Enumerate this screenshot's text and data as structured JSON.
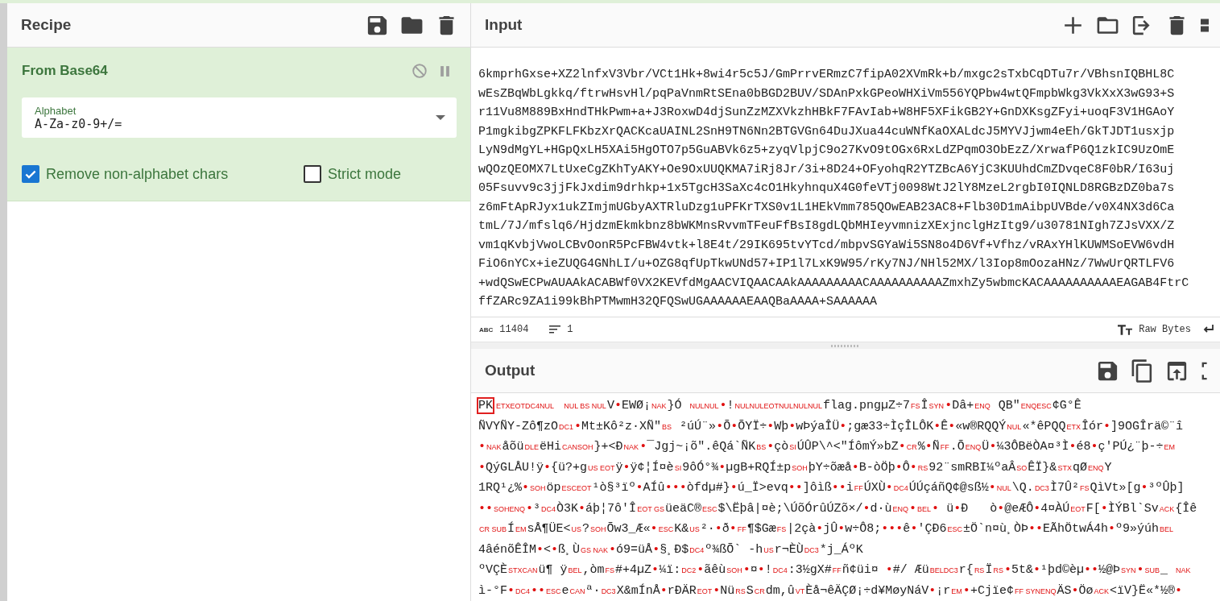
{
  "recipe": {
    "title": "Recipe",
    "operations": [
      {
        "name": "From Base64",
        "args": [
          {
            "kind": "dropdown",
            "label": "Alphabet",
            "value": "A-Za-z0-9+/="
          },
          {
            "kind": "checkbox",
            "label": "Remove non-alphabet chars",
            "checked": true
          },
          {
            "kind": "checkbox",
            "label": "Strict mode",
            "checked": false
          }
        ]
      }
    ]
  },
  "input": {
    "title": "Input",
    "lines": [
      "6kmprhGxse+XZ2lnfxV3Vbr/VCt1Hk+8wi4r5c5J/GmPrrvERmzC7fipA02XVmRk+b/mxgc2sTxbCqDTu7r/VBhsnIQBHL8C",
      "wEsZBqWbLgkkq/ftrwHsvHl/pqPaVnmRtSEna0bBGD2BUV/SDAnPxkGPeoWHXiVm556YQPbw4wtQFmpbWkg3VkXxX3wG93+S",
      "r11Vu8M889BxHndTHkPwm+a+J3RoxwD4djSunZzMZXVkzhHBkF7FAvIab+W8HF5XFikGB2Y+GnDXKsgZFyi+uoqF3V1HGAoY",
      "P1mgkibgZPKFLFKbzXrQACKcaUAINL2SnH9TN6Nn2BTGVGn64DuJXua44cuWNfKaOXALdcJ5MYVJjwm4eEh/GkTJDT1usxjp",
      "LyN9dMgYL+HGpQxLH5XAi5HgOTO7p5GuABVk6z5+zyqVlpjC9o27KvO9tOGx6RxLdZPqmO3ObEzZ/XrwafP6Q1zkIC9UzOmE",
      "wQOzQEOMX7LtUxeCgZKhTyAKY+Oe9OxUUQKMA7iRj8Jr/3i+8D24+OFyohqR2YTZBcA6YjC3KUUhdCmZDvqeC8F0bR/I63uj",
      "05Fsuvv9c3jjFkJxdim9drhkp+1x5TgcH3SaXc4cO1HkyhnquX4G0feVTj0098WtJ2lY8MzeL2rgbI0IQNLD8RGBzDZ0ba7s",
      "z6mFtApRJyx1ukZImjmUGbyAXTRluDzg1uPFKrTXS0v1L1HEkVmm785QOwEAB23AC8+Flb30D1mAibpUVBde/v0X4NX3d6Ca",
      "tmL/7J/mfslq6/HjdzmEkmkbnz8bWKMnsRvvmTFeuFfBsI8gdLQbMHIeyvmnizXExjnclgHzItg9/u30781NIgh7ZJsVXX/Z",
      "vm1qKvbjVwoLCBvOonR5PcFBW4vtk+l8E4t/29IK695tvYTcd/mbpvSGYaWi5SN8o4D6Vf+Vfhz/vRAxYHlKUWMSoEVW6vdH",
      "FiO6nYCx+ieZUQG4GNhLI/u+OZG8qfUpTkwUNd57+IP1l7LxK9W95/rKy7NJ/NHl52MX/l3Iop8mOozaHNz/7WwUrQRTLFV6",
      "+wdQSwECPwAUAAkACABWf0VX2KEVfdMgAACVIQAACAAkAAAAAAAAACAAAAAAAAAAZmxhZy5wbmcKACAAAAAAAAAAEAGAB4FtrC",
      "ffZARc9ZA1i99kBhPTMwmH32QFQSwUGAAAAAAEAAQBaAAAA+SAAAAAA"
    ],
    "status": {
      "length_label": "ABC",
      "length": "11404",
      "lines": "1",
      "encoding": "Raw Bytes"
    }
  },
  "output": {
    "title": "Output",
    "lines": [
      [
        {
          "kind": "marked",
          "text": "PK"
        },
        {
          "kind": "ctrl",
          "text": "ETXEOTDC4NUL     NUL BS NUL"
        },
        {
          "kind": "text",
          "text": "V"
        },
        {
          "kind": "dot",
          "text": "•"
        },
        {
          "kind": "text",
          "text": "EWØ¡"
        },
        {
          "kind": "ctrl",
          "text": "NAK"
        },
        {
          "kind": "text",
          "text": "}Ó "
        },
        {
          "kind": "ctrl",
          "text": "NULNUL"
        },
        {
          "kind": "dot",
          "text": "•"
        },
        {
          "kind": "text",
          "text": "!"
        },
        {
          "kind": "ctrl",
          "text": "NULNULEOTNULNULNUL"
        },
        {
          "kind": "text",
          "text": "flag.pngµZ÷7"
        },
        {
          "kind": "ctrl",
          "text": "FS"
        },
        {
          "kind": "text",
          "text": "Î"
        },
        {
          "kind": "ctrl",
          "text": "SYN"
        },
        {
          "kind": "dot",
          "text": "•"
        },
        {
          "kind": "text",
          "text": "Dâ+"
        },
        {
          "kind": "ctrl",
          "text": "ENQ"
        },
        {
          "kind": "text",
          "text": " QB\""
        },
        {
          "kind": "ctrl",
          "text": "ENQESC"
        },
        {
          "kind": "text",
          "text": "¢G°Ê"
        }
      ],
      [
        {
          "kind": "text",
          "text": "ÑVYÑY-Zô¶zO"
        },
        {
          "kind": "ctrl",
          "text": "DC1"
        },
        {
          "kind": "dot",
          "text": "•"
        },
        {
          "kind": "text",
          "text": "Mt±Kô²z·XÑ\""
        },
        {
          "kind": "ctrl",
          "text": "BS"
        },
        {
          "kind": "text",
          "text": " ²úÚ¨»"
        },
        {
          "kind": "dot",
          "text": "•"
        },
        {
          "kind": "text",
          "text": "Õ"
        },
        {
          "kind": "dot",
          "text": "•"
        },
        {
          "kind": "text",
          "text": "ÕYÏ÷"
        },
        {
          "kind": "dot",
          "text": "•"
        },
        {
          "kind": "text",
          "text": "Wþ"
        },
        {
          "kind": "dot",
          "text": "•"
        },
        {
          "kind": "text",
          "text": "wÞýaÎÜ"
        },
        {
          "kind": "dot",
          "text": "•"
        },
        {
          "kind": "text",
          "text": ";gæ33÷ÌçÎLÔK"
        },
        {
          "kind": "dot",
          "text": "•"
        },
        {
          "kind": "text",
          "text": "Ê"
        },
        {
          "kind": "dot",
          "text": "•"
        },
        {
          "kind": "text",
          "text": "«w®RQQÝ"
        },
        {
          "kind": "ctrl",
          "text": "NUL"
        },
        {
          "kind": "text",
          "text": "«*êPQQ"
        },
        {
          "kind": "ctrl",
          "text": "ETX"
        },
        {
          "kind": "text",
          "text": "Îór"
        },
        {
          "kind": "dot",
          "text": "•"
        },
        {
          "kind": "text",
          "text": "]9OGÎrä©¨î"
        }
      ],
      [
        {
          "kind": "dot",
          "text": "•"
        },
        {
          "kind": "ctrl",
          "text": "NAK"
        },
        {
          "kind": "text",
          "text": "åõü"
        },
        {
          "kind": "ctrl",
          "text": "DLE"
        },
        {
          "kind": "text",
          "text": "ëHi"
        },
        {
          "kind": "ctrl",
          "text": "CANSOH"
        },
        {
          "kind": "text",
          "text": "}+<Ð"
        },
        {
          "kind": "ctrl",
          "text": "NAK"
        },
        {
          "kind": "dot",
          "text": "•"
        },
        {
          "kind": "text",
          "text": "¯Jgj~¡õ\".êQá`ÑK"
        },
        {
          "kind": "ctrl",
          "text": "BS"
        },
        {
          "kind": "dot",
          "text": "•"
        },
        {
          "kind": "text",
          "text": "çò"
        },
        {
          "kind": "ctrl",
          "text": "SI"
        },
        {
          "kind": "text",
          "text": "ÚÛP\\^<\"ÍômÝ»bZ"
        },
        {
          "kind": "dot",
          "text": "•"
        },
        {
          "kind": "ctrl",
          "text": "CR"
        },
        {
          "kind": "text",
          "text": "%"
        },
        {
          "kind": "dot",
          "text": "•"
        },
        {
          "kind": "text",
          "text": "Ñ"
        },
        {
          "kind": "ctrl",
          "text": "FF"
        },
        {
          "kind": "text",
          "text": ".Õ"
        },
        {
          "kind": "ctrl",
          "text": "ENQ"
        },
        {
          "kind": "text",
          "text": "Ü"
        },
        {
          "kind": "dot",
          "text": "•"
        },
        {
          "kind": "text",
          "text": "¼3ÔBëÒA¤³Ì"
        },
        {
          "kind": "dot",
          "text": "•"
        },
        {
          "kind": "text",
          "text": "é8"
        },
        {
          "kind": "dot",
          "text": "•"
        },
        {
          "kind": "text",
          "text": "ç'PÚ¿¨þ-÷"
        },
        {
          "kind": "ctrl",
          "text": "EM"
        }
      ],
      [
        {
          "kind": "dot",
          "text": "•"
        },
        {
          "kind": "text",
          "text": "QýGLÅU!ÿ"
        },
        {
          "kind": "dot",
          "text": "•"
        },
        {
          "kind": "text",
          "text": "{ü?+g"
        },
        {
          "kind": "ctrl",
          "text": "US EOT"
        },
        {
          "kind": "text",
          "text": "ÿ"
        },
        {
          "kind": "dot",
          "text": "•"
        },
        {
          "kind": "text",
          "text": "ÿ¢¦Í¤è"
        },
        {
          "kind": "ctrl",
          "text": "SI"
        },
        {
          "kind": "text",
          "text": "9ôÓ°¾"
        },
        {
          "kind": "dot",
          "text": "•"
        },
        {
          "kind": "text",
          "text": "µgB+RQÍ±p"
        },
        {
          "kind": "ctrl",
          "text": "SOH"
        },
        {
          "kind": "text",
          "text": "þY÷õæå"
        },
        {
          "kind": "dot",
          "text": "•"
        },
        {
          "kind": "text",
          "text": "B-òÖþ"
        },
        {
          "kind": "dot",
          "text": "•"
        },
        {
          "kind": "text",
          "text": "Ô"
        },
        {
          "kind": "dot",
          "text": "•"
        },
        {
          "kind": "ctrl",
          "text": "RS"
        },
        {
          "kind": "text",
          "text": "92¨smRBI¼ºaÂ"
        },
        {
          "kind": "ctrl",
          "text": "SO"
        },
        {
          "kind": "text",
          "text": "ÊÏ}&"
        },
        {
          "kind": "ctrl",
          "text": "STX"
        },
        {
          "kind": "text",
          "text": "qØ"
        },
        {
          "kind": "ctrl",
          "text": "ENQ"
        },
        {
          "kind": "text",
          "text": "Y"
        }
      ],
      [
        {
          "kind": "text",
          "text": "1RQ¹¿%"
        },
        {
          "kind": "dot",
          "text": "•"
        },
        {
          "kind": "ctrl",
          "text": "SOH"
        },
        {
          "kind": "text",
          "text": "öp"
        },
        {
          "kind": "ctrl",
          "text": "ESCEOT"
        },
        {
          "kind": "text",
          "text": "¹ò§³ïº"
        },
        {
          "kind": "dot",
          "text": "•"
        },
        {
          "kind": "text",
          "text": "AÍû"
        },
        {
          "kind": "dot",
          "text": "•••"
        },
        {
          "kind": "text",
          "text": "òfdµ#}"
        },
        {
          "kind": "dot",
          "text": "•"
        },
        {
          "kind": "text",
          "text": "ú_Ï>evq"
        },
        {
          "kind": "dot",
          "text": "••"
        },
        {
          "kind": "text",
          "text": "]ôìß"
        },
        {
          "kind": "dot",
          "text": "••"
        },
        {
          "kind": "text",
          "text": "i"
        },
        {
          "kind": "ctrl",
          "text": "FF"
        },
        {
          "kind": "text",
          "text": "ÚXÙ"
        },
        {
          "kind": "dot",
          "text": "•"
        },
        {
          "kind": "ctrl",
          "text": "DC4"
        },
        {
          "kind": "text",
          "text": "ÚÚçáñQ¢@sß½"
        },
        {
          "kind": "dot",
          "text": "•"
        },
        {
          "kind": "ctrl",
          "text": "NUL"
        },
        {
          "kind": "text",
          "text": "\\Q."
        },
        {
          "kind": "ctrl",
          "text": "DC3"
        },
        {
          "kind": "text",
          "text": "Ì7Û²"
        },
        {
          "kind": "ctrl",
          "text": "FS"
        },
        {
          "kind": "text",
          "text": "QìVt»[g"
        },
        {
          "kind": "dot",
          "text": "•"
        },
        {
          "kind": "text",
          "text": "³ºÛþ]"
        }
      ],
      [
        {
          "kind": "dot",
          "text": "••"
        },
        {
          "kind": "ctrl",
          "text": "SOHENQ"
        },
        {
          "kind": "dot",
          "text": "•"
        },
        {
          "kind": "text",
          "text": "³"
        },
        {
          "kind": "ctrl",
          "text": "DC4"
        },
        {
          "kind": "text",
          "text": "Ò3K"
        },
        {
          "kind": "dot",
          "text": "•"
        },
        {
          "kind": "text",
          "text": "áþ¦7ô'Î"
        },
        {
          "kind": "ctrl",
          "text": "EOT GS"
        },
        {
          "kind": "text",
          "text": "üeäC®"
        },
        {
          "kind": "ctrl",
          "text": "ESC"
        },
        {
          "kind": "text",
          "text": "$\\Ëþâ|¤è;\\ÚõÓrûÚZõ×/"
        },
        {
          "kind": "dot",
          "text": "•"
        },
        {
          "kind": "text",
          "text": "d·ù"
        },
        {
          "kind": "ctrl",
          "text": "ENQ"
        },
        {
          "kind": "dot",
          "text": "•"
        },
        {
          "kind": "ctrl",
          "text": "BEL"
        },
        {
          "kind": "dot",
          "text": "•"
        },
        {
          "kind": "text",
          "text": " ü"
        },
        {
          "kind": "dot",
          "text": "•"
        },
        {
          "kind": "text",
          "text": "Ð   ò"
        },
        {
          "kind": "dot",
          "text": "•"
        },
        {
          "kind": "text",
          "text": "@eÆÔ"
        },
        {
          "kind": "dot",
          "text": "•"
        },
        {
          "kind": "text",
          "text": "4¤ÀÚ"
        },
        {
          "kind": "ctrl",
          "text": "EOT"
        },
        {
          "kind": "text",
          "text": "F["
        },
        {
          "kind": "dot",
          "text": "•"
        },
        {
          "kind": "text",
          "text": "ÌÝBl`Sv"
        },
        {
          "kind": "ctrl",
          "text": "ACK"
        },
        {
          "kind": "text",
          "text": "{Îê"
        }
      ],
      [
        {
          "kind": "ctrl",
          "text": "CR SUB"
        },
        {
          "kind": "text",
          "text": "Í"
        },
        {
          "kind": "ctrl",
          "text": "EM"
        },
        {
          "kind": "text",
          "text": "sÅ¶ÜE<"
        },
        {
          "kind": "ctrl",
          "text": "US"
        },
        {
          "kind": "text",
          "text": "?"
        },
        {
          "kind": "ctrl",
          "text": "SOH"
        },
        {
          "kind": "text",
          "text": "Õw3_Æ«"
        },
        {
          "kind": "dot",
          "text": "•"
        },
        {
          "kind": "ctrl",
          "text": "ESC"
        },
        {
          "kind": "text",
          "text": "K&"
        },
        {
          "kind": "ctrl",
          "text": "US"
        },
        {
          "kind": "text",
          "text": "²·"
        },
        {
          "kind": "dot",
          "text": "•"
        },
        {
          "kind": "text",
          "text": "ð"
        },
        {
          "kind": "dot",
          "text": "•"
        },
        {
          "kind": "ctrl",
          "text": "FF"
        },
        {
          "kind": "text",
          "text": "¶$Gæ"
        },
        {
          "kind": "ctrl",
          "text": "FS"
        },
        {
          "kind": "text",
          "text": "|2çà"
        },
        {
          "kind": "dot",
          "text": "•"
        },
        {
          "kind": "text",
          "text": "jÛ"
        },
        {
          "kind": "dot",
          "text": "•"
        },
        {
          "kind": "text",
          "text": "w÷Ô8;"
        },
        {
          "kind": "dot",
          "text": "•••"
        },
        {
          "kind": "text",
          "text": "ê"
        },
        {
          "kind": "dot",
          "text": "•"
        },
        {
          "kind": "text",
          "text": "'ÇÐ6"
        },
        {
          "kind": "ctrl",
          "text": "ESC"
        },
        {
          "kind": "text",
          "text": "±Ö`n¤ù¸ÒÞ"
        },
        {
          "kind": "dot",
          "text": "••"
        },
        {
          "kind": "text",
          "text": "EÃhÖtwÁ4h"
        },
        {
          "kind": "dot",
          "text": "•"
        },
        {
          "kind": "text",
          "text": "º9»ýúh"
        },
        {
          "kind": "ctrl",
          "text": "BEL"
        }
      ],
      [
        {
          "kind": "text",
          "text": "4âénõÊÎM"
        },
        {
          "kind": "dot",
          "text": "•"
        },
        {
          "kind": "text",
          "text": "<"
        },
        {
          "kind": "dot",
          "text": "•"
        },
        {
          "kind": "text",
          "text": "ß¸Ù"
        },
        {
          "kind": "ctrl",
          "text": "GS NAK"
        },
        {
          "kind": "dot",
          "text": "•"
        },
        {
          "kind": "text",
          "text": "ó9=üÅ"
        },
        {
          "kind": "dot",
          "text": "•"
        },
        {
          "kind": "text",
          "text": "§¸Ð$"
        },
        {
          "kind": "ctrl",
          "text": "DC4"
        },
        {
          "kind": "text",
          "text": "º¾ßÕ` -h"
        },
        {
          "kind": "ctrl",
          "text": "US"
        },
        {
          "kind": "text",
          "text": "r¬ÈÙ"
        },
        {
          "kind": "ctrl",
          "text": "DC3"
        },
        {
          "kind": "text",
          "text": "*j_ÁºK"
        }
      ],
      [
        {
          "kind": "text",
          "text": "ºVÇÈ"
        },
        {
          "kind": "ctrl",
          "text": "STXCAN"
        },
        {
          "kind": "text",
          "text": "ü¶ ÿ"
        },
        {
          "kind": "ctrl",
          "text": "BEL"
        },
        {
          "kind": "text",
          "text": ",òm"
        },
        {
          "kind": "ctrl",
          "text": "FS"
        },
        {
          "kind": "text",
          "text": "#+4µZ"
        },
        {
          "kind": "dot",
          "text": "•"
        },
        {
          "kind": "text",
          "text": "¼ï:"
        },
        {
          "kind": "ctrl",
          "text": "DC2"
        },
        {
          "kind": "dot",
          "text": "•"
        },
        {
          "kind": "text",
          "text": "ãêù"
        },
        {
          "kind": "ctrl",
          "text": "SOH"
        },
        {
          "kind": "dot",
          "text": "•"
        },
        {
          "kind": "text",
          "text": "¤"
        },
        {
          "kind": "dot",
          "text": "•"
        },
        {
          "kind": "text",
          "text": "!"
        },
        {
          "kind": "ctrl",
          "text": "DC4"
        },
        {
          "kind": "text",
          "text": ":3½gX#"
        },
        {
          "kind": "ctrl",
          "text": "FF"
        },
        {
          "kind": "text",
          "text": "ñ¢üi¤ "
        },
        {
          "kind": "dot",
          "text": "•"
        },
        {
          "kind": "text",
          "text": "#/ Æü"
        },
        {
          "kind": "ctrl",
          "text": "BELDC3"
        },
        {
          "kind": "text",
          "text": "r{"
        },
        {
          "kind": "ctrl",
          "text": "RS"
        },
        {
          "kind": "text",
          "text": "Ï"
        },
        {
          "kind": "ctrl",
          "text": "RS"
        },
        {
          "kind": "dot",
          "text": "•"
        },
        {
          "kind": "text",
          "text": "5t&"
        },
        {
          "kind": "dot",
          "text": "•"
        },
        {
          "kind": "text",
          "text": "¹þd©èµ"
        },
        {
          "kind": "dot",
          "text": "••"
        },
        {
          "kind": "text",
          "text": "½@Þ"
        },
        {
          "kind": "ctrl",
          "text": "SYN"
        },
        {
          "kind": "dot",
          "text": "•"
        },
        {
          "kind": "ctrl",
          "text": "SUB"
        },
        {
          "kind": "text",
          "text": "_ "
        },
        {
          "kind": "ctrl",
          "text": "NAK"
        }
      ],
      [
        {
          "kind": "text",
          "text": "ì-°F"
        },
        {
          "kind": "dot",
          "text": "•"
        },
        {
          "kind": "ctrl",
          "text": "DC4"
        },
        {
          "kind": "dot",
          "text": "••"
        },
        {
          "kind": "ctrl",
          "text": "ESC"
        },
        {
          "kind": "text",
          "text": "e"
        },
        {
          "kind": "ctrl",
          "text": "CAN"
        },
        {
          "kind": "text",
          "text": "ª·"
        },
        {
          "kind": "ctrl",
          "text": "DC3"
        },
        {
          "kind": "text",
          "text": "X&mÍnÅ"
        },
        {
          "kind": "dot",
          "text": "•"
        },
        {
          "kind": "text",
          "text": "rÐÄR"
        },
        {
          "kind": "ctrl",
          "text": "EOT"
        },
        {
          "kind": "dot",
          "text": "•"
        },
        {
          "kind": "text",
          "text": "Nü"
        },
        {
          "kind": "ctrl",
          "text": "RS"
        },
        {
          "kind": "text",
          "text": "S"
        },
        {
          "kind": "ctrl",
          "text": "CR"
        },
        {
          "kind": "text",
          "text": "dm,û"
        },
        {
          "kind": "ctrl",
          "text": "VT"
        },
        {
          "kind": "text",
          "text": "Èå¬êÄÇØ¡÷d¥MøyNáV"
        },
        {
          "kind": "dot",
          "text": "•"
        },
        {
          "kind": "text",
          "text": "¡r"
        },
        {
          "kind": "ctrl",
          "text": "EM"
        },
        {
          "kind": "dot",
          "text": "•"
        },
        {
          "kind": "text",
          "text": "+Cjïe¢"
        },
        {
          "kind": "ctrl",
          "text": "FF SYNENQ"
        },
        {
          "kind": "text",
          "text": "ÄS"
        },
        {
          "kind": "dot",
          "text": "•"
        },
        {
          "kind": "text",
          "text": "Öø"
        },
        {
          "kind": "ctrl",
          "text": "ACK"
        },
        {
          "kind": "text",
          "text": "<ïV}Ë«*½®"
        },
        {
          "kind": "dot",
          "text": "•"
        }
      ]
    ]
  }
}
